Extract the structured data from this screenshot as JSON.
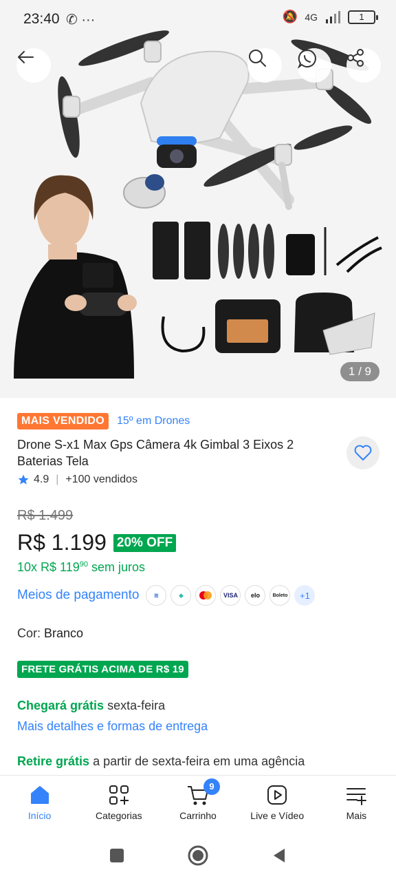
{
  "status_bar": {
    "time": "23:40",
    "network": "4G",
    "battery": "1"
  },
  "gallery": {
    "counter": "1 / 9"
  },
  "product": {
    "badge": "MAIS VENDIDO",
    "rank": "15º em Drones",
    "title": "Drone S-x1 Max Gps Câmera 4k Gimbal 3 Eixos 2 Baterias Tela",
    "rating": "4.9",
    "sold": "+100 vendidos",
    "old_price": "R$ 1.499",
    "price": "R$ 1.199",
    "discount": "20% OFF",
    "installments_prefix": "10x R$ 119",
    "installments_cents": "90",
    "installments_suffix": "sem juros",
    "payment_label": "Meios de pagamento",
    "payment_more": "+1",
    "color_label": "Cor:",
    "color_value": "Branco",
    "free_shipping": "FRETE GRÁTIS ACIMA DE R$ 19",
    "arrival_bold": "Chegará grátis",
    "arrival_rest": "sexta-feira",
    "details_link": "Mais detalhes e formas de entrega",
    "pickup_bold": "Retire grátis",
    "pickup_rest": "a partir de sexta-feira em uma agência"
  },
  "payment_methods": [
    "bank-icon",
    "pix-icon",
    "mastercard-icon",
    "visa-icon",
    "elo-icon",
    "boleto-icon"
  ],
  "payment_texts": {
    "visa": "VISA",
    "elo": "elo",
    "boleto": "Boleto"
  },
  "bottom_nav": [
    {
      "label": "Início",
      "icon": "home-icon",
      "active": true
    },
    {
      "label": "Categorias",
      "icon": "categories-icon"
    },
    {
      "label": "Carrinho",
      "icon": "cart-icon",
      "badge": "9"
    },
    {
      "label": "Live e Vídeo",
      "icon": "play-icon"
    },
    {
      "label": "Mais",
      "icon": "menu-plus-icon"
    }
  ],
  "colors": {
    "accent_blue": "#3483fa",
    "green": "#00a650",
    "badge_orange": "#ff7733"
  }
}
